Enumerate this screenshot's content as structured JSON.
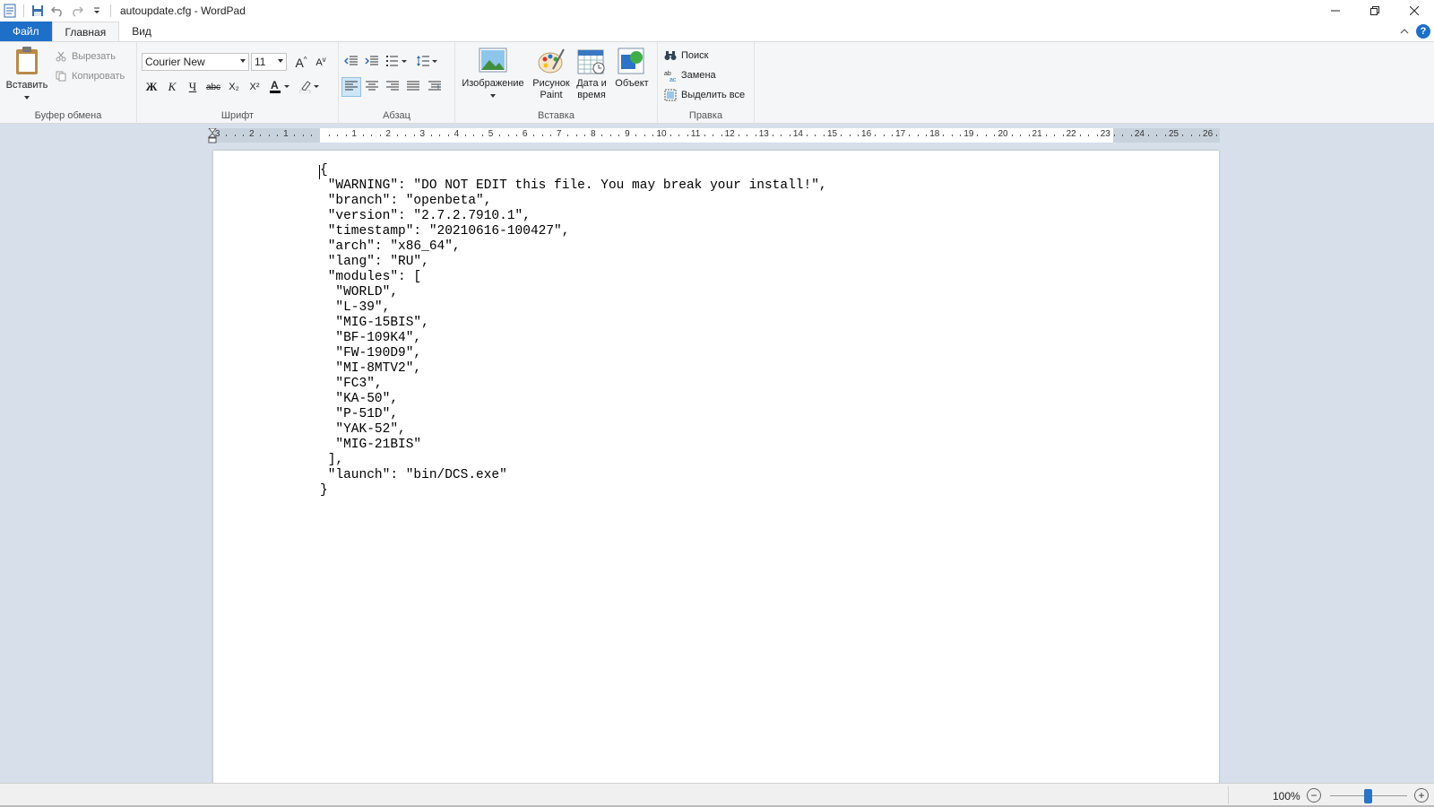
{
  "window": {
    "title": "autoupdate.cfg - WordPad"
  },
  "tabs": [
    {
      "label": "Файл"
    },
    {
      "label": "Главная"
    },
    {
      "label": "Вид"
    }
  ],
  "clipboard": {
    "paste": "Вставить",
    "cut": "Вырезать",
    "copy": "Копировать",
    "group": "Буфер обмена"
  },
  "font": {
    "family": "Courier New",
    "size": "11",
    "group": "Шрифт",
    "bold": "Ж",
    "italic": "К",
    "underline": "Ч",
    "strike": "abc",
    "subscript": "X₂",
    "superscript": "X²",
    "grow": "A",
    "shrink": "A"
  },
  "paragraph": {
    "group": "Абзац"
  },
  "insert": {
    "image": "Изображение",
    "paint_line1": "Рисунок",
    "paint_line2": "Paint",
    "datetime_line1": "Дата и",
    "datetime_line2": "время",
    "object": "Объект",
    "group": "Вставка"
  },
  "editing": {
    "find": "Поиск",
    "replace": "Замена",
    "select_all": "Выделить все",
    "group": "Правка"
  },
  "ruler": {
    "left_labels": [
      "3",
      "2",
      "1"
    ],
    "right_labels": [
      "1",
      "2",
      "3",
      "4",
      "5",
      "6",
      "7",
      "8",
      "9",
      "10",
      "11",
      "12",
      "13",
      "14",
      "15",
      "16",
      "17",
      "18",
      "19",
      "20",
      "21",
      "22",
      "23",
      "24",
      "25",
      "26"
    ]
  },
  "document": {
    "text": "{\n \"WARNING\": \"DO NOT EDIT this file. You may break your install!\",\n \"branch\": \"openbeta\",\n \"version\": \"2.7.2.7910.1\",\n \"timestamp\": \"20210616-100427\",\n \"arch\": \"x86_64\",\n \"lang\": \"RU\",\n \"modules\": [\n  \"WORLD\",\n  \"L-39\",\n  \"MIG-15BIS\",\n  \"BF-109K4\",\n  \"FW-190D9\",\n  \"MI-8MTV2\",\n  \"FC3\",\n  \"KA-50\",\n  \"P-51D\",\n  \"YAK-52\",\n  \"MIG-21BIS\"\n ],\n \"launch\": \"bin/DCS.exe\"\n}"
  },
  "status": {
    "zoom": "100%",
    "zoom_level_percent": 100
  },
  "colors": {
    "accent": "#1e6fc7",
    "workspace": "#d6dfea"
  }
}
